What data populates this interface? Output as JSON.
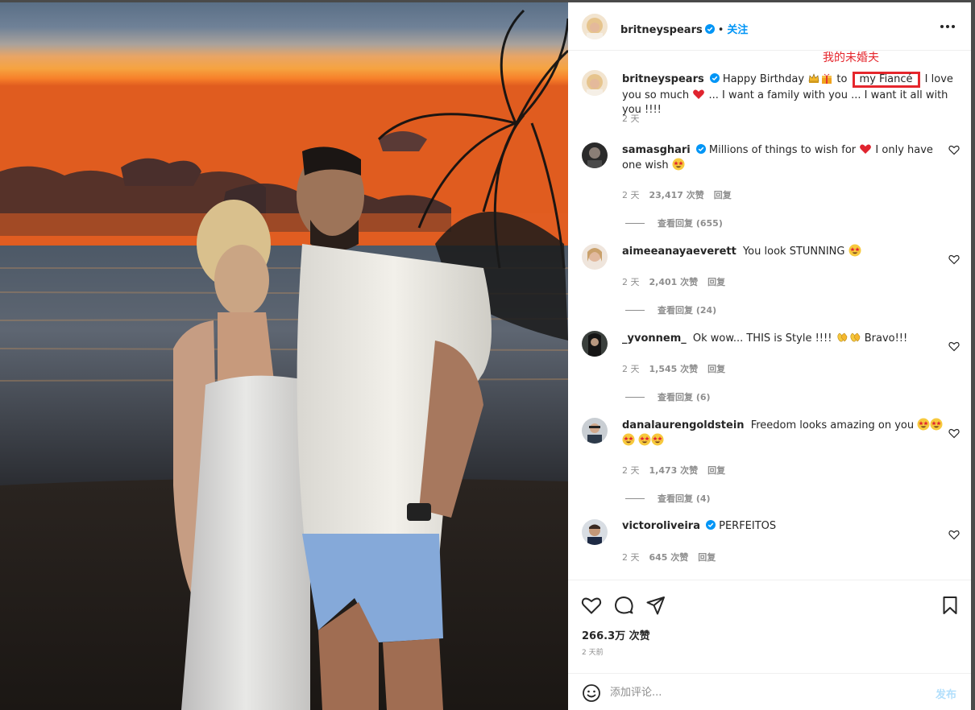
{
  "post": {
    "photo_icon": "couple-sunset-beach-photo",
    "author": "britneyspears",
    "follow_label": "关注",
    "header_separator": "•",
    "more_icon": "more-horizontal-icon"
  },
  "caption": {
    "username": "britneyspears",
    "text_before": "Happy Birthday",
    "emoji_1": "crown-emoji",
    "emoji_2": "gift-emoji",
    "text_to": "to",
    "highlight_text": "my Fiancé",
    "text_after": "I love you so much",
    "emoji_heart": "red-heart-emoji",
    "text_end": "... I want a family with you ... I want it all with you !!!!",
    "annotation": "我的未婚夫",
    "time": "2 天"
  },
  "comments": [
    {
      "username": "samasghari",
      "verified": true,
      "text": "Millions of things to wish for",
      "emoji_mid": "red-heart-emoji",
      "text2": "I only have one wish",
      "emoji_end": "star-struck-emoji",
      "time": "2 天",
      "likes": "23,417 次赞",
      "reply": "回复",
      "view_replies": "查看回复 (655)"
    },
    {
      "username": "aimeeanayaeverett",
      "verified": false,
      "text": "You look STUNNING",
      "emoji_end": "star-struck-emoji",
      "time": "2 天",
      "likes": "2,401 次赞",
      "reply": "回复",
      "view_replies": "查看回复 (24)"
    },
    {
      "username": "_yvonnem_",
      "verified": false,
      "text": "Ok wow... THIS is Style !!!!",
      "emoji_mid": "clapping-hands-emoji",
      "text2": "Bravo!!!",
      "time": "2 天",
      "likes": "1,545 次赞",
      "reply": "回复",
      "view_replies": "查看回复 (6)"
    },
    {
      "username": "danalaurengoldstein",
      "verified": false,
      "text": "Freedom looks amazing on you",
      "emoji_end": "star-struck-emoji",
      "time": "2 天",
      "likes": "1,473 次赞",
      "reply": "回复",
      "view_replies": "查看回复 (4)"
    },
    {
      "username": "victoroliveira",
      "verified": true,
      "text": "PERFEITOS",
      "time": "2 天",
      "likes": "645 次赞",
      "reply": "回复"
    }
  ],
  "actions": {
    "like_icon": "heart-icon",
    "comment_icon": "comment-bubble-icon",
    "share_icon": "paper-plane-icon",
    "save_icon": "bookmark-icon"
  },
  "stats": {
    "likes_total": "266.3万 次赞",
    "posted": "2 天前"
  },
  "add_comment": {
    "emoji_icon": "smiley-icon",
    "placeholder": "添加评论...",
    "post_label": "发布"
  },
  "colors": {
    "link_blue": "#0095f6",
    "annotation_red": "#e5262c",
    "muted_gray": "#8e8e8e",
    "post_disabled": "#b2dffc"
  }
}
